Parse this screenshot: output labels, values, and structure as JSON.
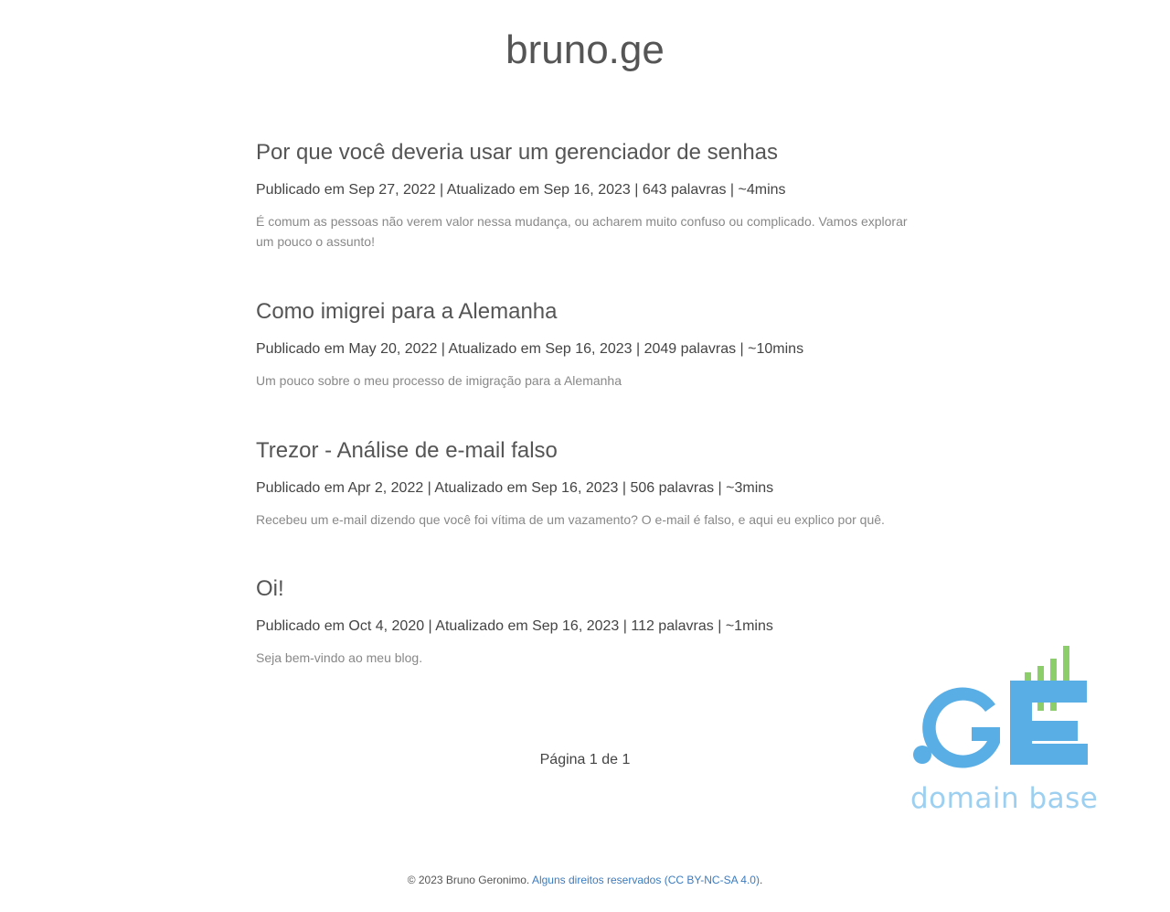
{
  "site": {
    "title": "bruno.ge"
  },
  "posts": [
    {
      "title": "Por que você deveria usar um gerenciador de senhas",
      "meta": "Publicado em Sep 27, 2022 | Atualizado em Sep 16, 2023 | 643 palavras | ~4mins",
      "excerpt": "É comum as pessoas não verem valor nessa mudança, ou acharem muito confuso ou complicado. Vamos explorar um pouco o assunto!"
    },
    {
      "title": "Como imigrei para a Alemanha",
      "meta": "Publicado em May 20, 2022 | Atualizado em Sep 16, 2023 | 2049 palavras | ~10mins",
      "excerpt": "Um pouco sobre o meu processo de imigração para a Alemanha"
    },
    {
      "title": "Trezor - Análise de e-mail falso",
      "meta": "Publicado em Apr 2, 2022 | Atualizado em Sep 16, 2023 | 506 palavras | ~3mins",
      "excerpt": "Recebeu um e-mail dizendo que você foi vítima de um vazamento? O e-mail é falso, e aqui eu explico por quê."
    },
    {
      "title": "Oi!",
      "meta": "Publicado em Oct 4, 2020 | Atualizado em Sep 16, 2023 | 112 palavras | ~1mins",
      "excerpt": "Seja bem-vindo ao meu blog."
    }
  ],
  "pagination": {
    "label": "Página 1 de 1"
  },
  "footer": {
    "copyright": "© 2023 Bruno Geronimo.",
    "license_link": "Alguns direitos reservados (CC BY-NC-SA 4.0)",
    "trailing": "."
  },
  "badge": {
    "logo_text": ".GE",
    "caption": "domain base",
    "colors": {
      "blue": "#5aaee6",
      "green": "#8ccf6a",
      "caption": "#9dd0f0"
    }
  },
  "colors": {
    "link": "#3b7bbf",
    "text": "#444444",
    "muted": "#888888"
  }
}
